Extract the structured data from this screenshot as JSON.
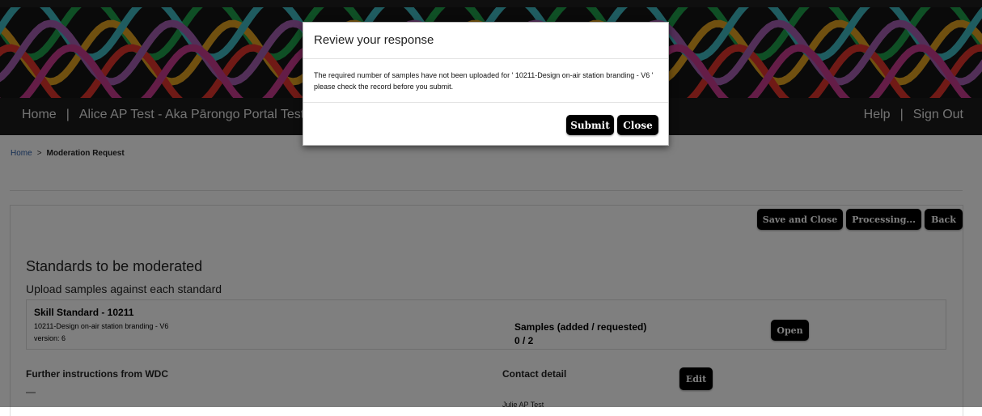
{
  "nav": {
    "home": "Home",
    "separator": "|",
    "org": "Alice AP Test - Aka Pārongo Portal Test C",
    "help": "Help",
    "sign_out": "Sign Out"
  },
  "breadcrumb": {
    "home": "Home",
    "separator": ">",
    "current": "Moderation Request"
  },
  "actions": {
    "save_close": "Save and Close",
    "processing": "Processing...",
    "back": "Back"
  },
  "standards": {
    "heading": "Standards to be moderated",
    "subheading": "Upload samples against each standard",
    "items": [
      {
        "title": "Skill Standard - 10211",
        "description": "10211-Design on-air station branding - V6",
        "version": "version: 6",
        "samples_label": "Samples (added / requested)",
        "samples_value": "0 / 2",
        "open_label": "Open"
      }
    ]
  },
  "further": {
    "heading": "Further instructions from WDC",
    "value": "—"
  },
  "contact": {
    "heading": "Contact detail",
    "edit_label": "Edit",
    "name": "Julie AP Test"
  },
  "modal": {
    "title": "Review your response",
    "message": "The required number of samples have not been uploaded for ' 10211-Design on-air station branding - V6 ' please check the record before you submit.",
    "submit_label": "Submit",
    "close_label": "Close"
  },
  "colors": {
    "banner_background": "#151515",
    "overlay": "rgba(0,0,0,0.5)",
    "button_background": "#000000",
    "link": "#2b5ea8",
    "braid_strands": [
      "#1e9e4a",
      "#e0a020",
      "#e0342c",
      "#3fb8c0",
      "#a45fb0",
      "#c83a8e"
    ]
  }
}
